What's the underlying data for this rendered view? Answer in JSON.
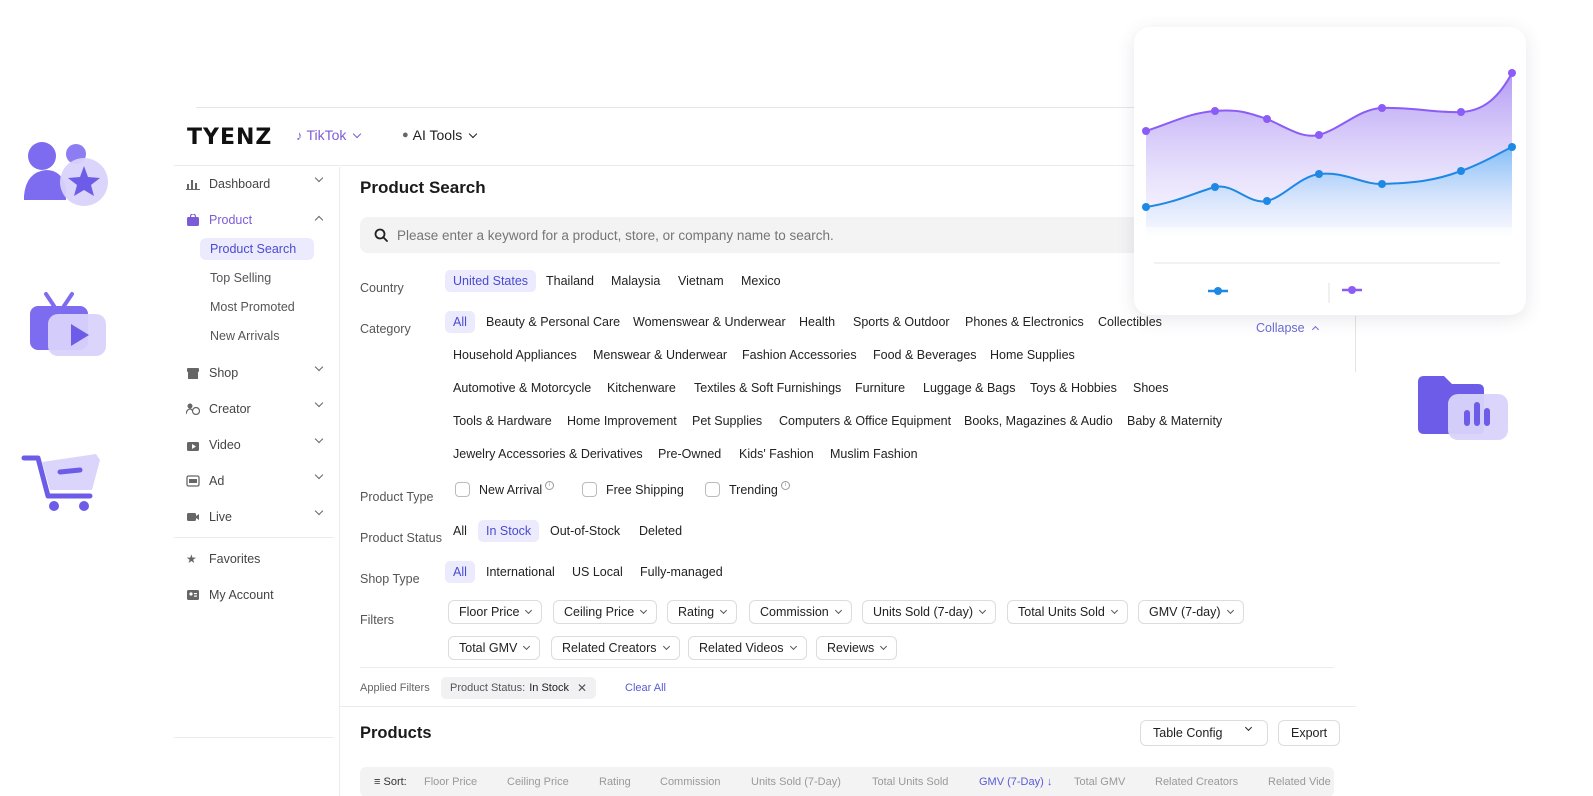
{
  "header": {
    "logo": "TYENZ",
    "platform": "TikTok",
    "ai_tools": "AI Tools"
  },
  "sidebar": {
    "items": [
      {
        "label": "Dashboard",
        "icon": "bar-chart-icon"
      },
      {
        "label": "Product",
        "icon": "bag-icon",
        "active": true,
        "sub": [
          "Product Search",
          "Top Selling",
          "Most Promoted",
          "New Arrivals"
        ]
      },
      {
        "label": "Shop",
        "icon": "shop-icon"
      },
      {
        "label": "Creator",
        "icon": "creator-icon"
      },
      {
        "label": "Video",
        "icon": "video-icon"
      },
      {
        "label": "Ad",
        "icon": "ad-icon"
      },
      {
        "label": "Live",
        "icon": "live-icon"
      }
    ],
    "favorites": "Favorites",
    "my_account": "My Account"
  },
  "main": {
    "title": "Product Search",
    "search_placeholder": "Please enter a keyword for a product, store, or company name to search.",
    "country": {
      "label": "Country",
      "options": [
        "United States",
        "Thailand",
        "Malaysia",
        "Vietnam",
        "Mexico"
      ],
      "selected": "United States"
    },
    "category": {
      "label": "Category",
      "collapse": "Collapse",
      "rows": [
        [
          "All",
          "Beauty & Personal Care",
          "Womenswear & Underwear",
          "Health",
          "Sports & Outdoor",
          "Phones & Electronics",
          "Collectibles"
        ],
        [
          "Household Appliances",
          "Menswear & Underwear",
          "Fashion Accessories",
          "Food & Beverages",
          "Home Supplies"
        ],
        [
          "Automotive & Motorcycle",
          "Kitchenware",
          "Textiles & Soft Furnishings",
          "Furniture",
          "Luggage & Bags",
          "Toys & Hobbies",
          "Shoes"
        ],
        [
          "Tools & Hardware",
          "Home Improvement",
          "Pet Supplies",
          "Computers & Office Equipment",
          "Books, Magazines & Audio",
          "Baby & Maternity"
        ],
        [
          "Jewelry Accessories & Derivatives",
          "Pre-Owned",
          "Kids' Fashion",
          "Muslim Fashion"
        ]
      ]
    },
    "product_type": {
      "label": "Product Type",
      "options": [
        "New Arrival",
        "Free Shipping",
        "Trending"
      ]
    },
    "product_status": {
      "label": "Product Status",
      "options": [
        "All",
        "In Stock",
        "Out-of-Stock",
        "Deleted"
      ],
      "selected": "In Stock"
    },
    "shop_type": {
      "label": "Shop Type",
      "options": [
        "All",
        "International",
        "US Local",
        "Fully-managed"
      ],
      "selected": "All"
    },
    "filters": {
      "label": "Filters",
      "row1": [
        "Floor Price",
        "Ceiling Price",
        "Rating",
        "Commission",
        "Units Sold (7-day)",
        "Total Units Sold",
        "GMV (7-day)"
      ],
      "row2": [
        "Total GMV",
        "Related Creators",
        "Related Videos",
        "Reviews"
      ]
    },
    "applied": {
      "label": "Applied Filters",
      "tag_key": "Product Status:",
      "tag_value": "In Stock",
      "clear_all": "Clear All"
    },
    "products": {
      "title": "Products",
      "table_config": "Table Config",
      "export": "Export",
      "sort_label": "Sort:",
      "sort_fields": [
        "Floor Price",
        "Ceiling Price",
        "Rating",
        "Commission",
        "Units Sold (7-Day)",
        "Total Units Sold",
        "GMV (7-Day)",
        "Total GMV",
        "Related Creators",
        "Related Vide"
      ]
    }
  },
  "colors": {
    "accent": "#7c5cd6",
    "selected_bg": "#ecebfd",
    "selected_text": "#4a4ad0",
    "chart_purple": "#8b5cf6",
    "chart_blue": "#1e88e5"
  }
}
